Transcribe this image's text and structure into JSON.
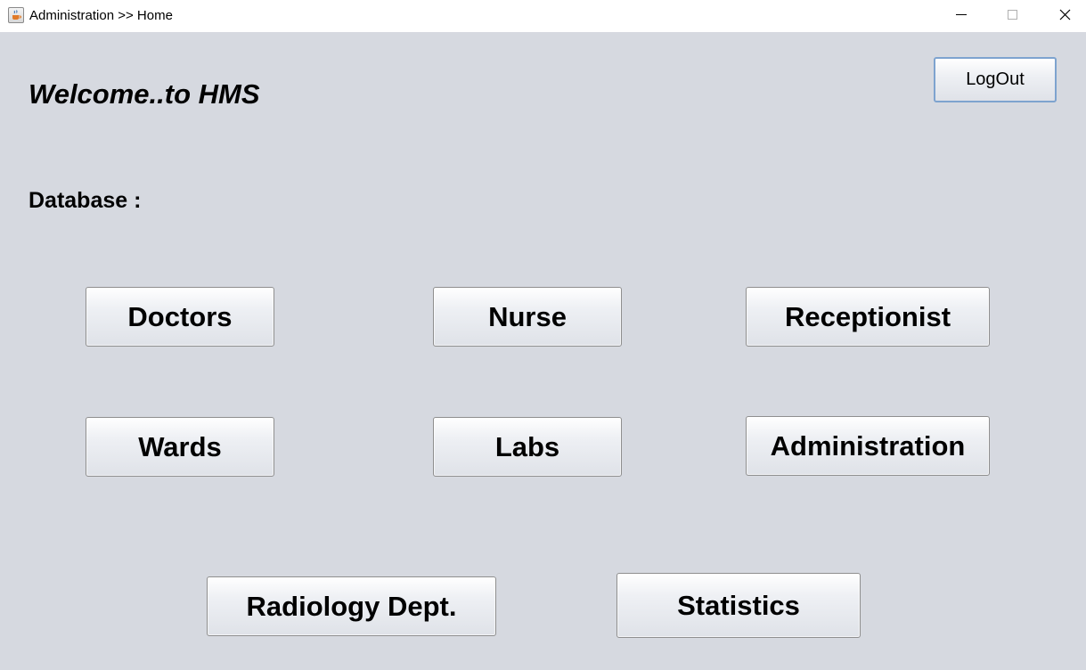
{
  "window": {
    "title": "Administration >> Home",
    "app_icon": "java-cup-icon",
    "controls": {
      "minimize_icon": "minimize-icon",
      "maximize_icon": "maximize-icon",
      "close_icon": "close-icon"
    }
  },
  "header": {
    "welcome": "Welcome..to HMS",
    "logout_label": "LogOut"
  },
  "database": {
    "label": "Database :",
    "buttons": [
      {
        "label": "Doctors"
      },
      {
        "label": "Nurse"
      },
      {
        "label": "Receptionist"
      },
      {
        "label": "Wards"
      },
      {
        "label": "Labs"
      },
      {
        "label": "Administration"
      },
      {
        "label": "Radiology Dept."
      },
      {
        "label": "Statistics"
      }
    ]
  },
  "colors": {
    "background": "#d6d9e0",
    "titlebar": "#ffffff",
    "focus_border": "#7ea3cf"
  }
}
